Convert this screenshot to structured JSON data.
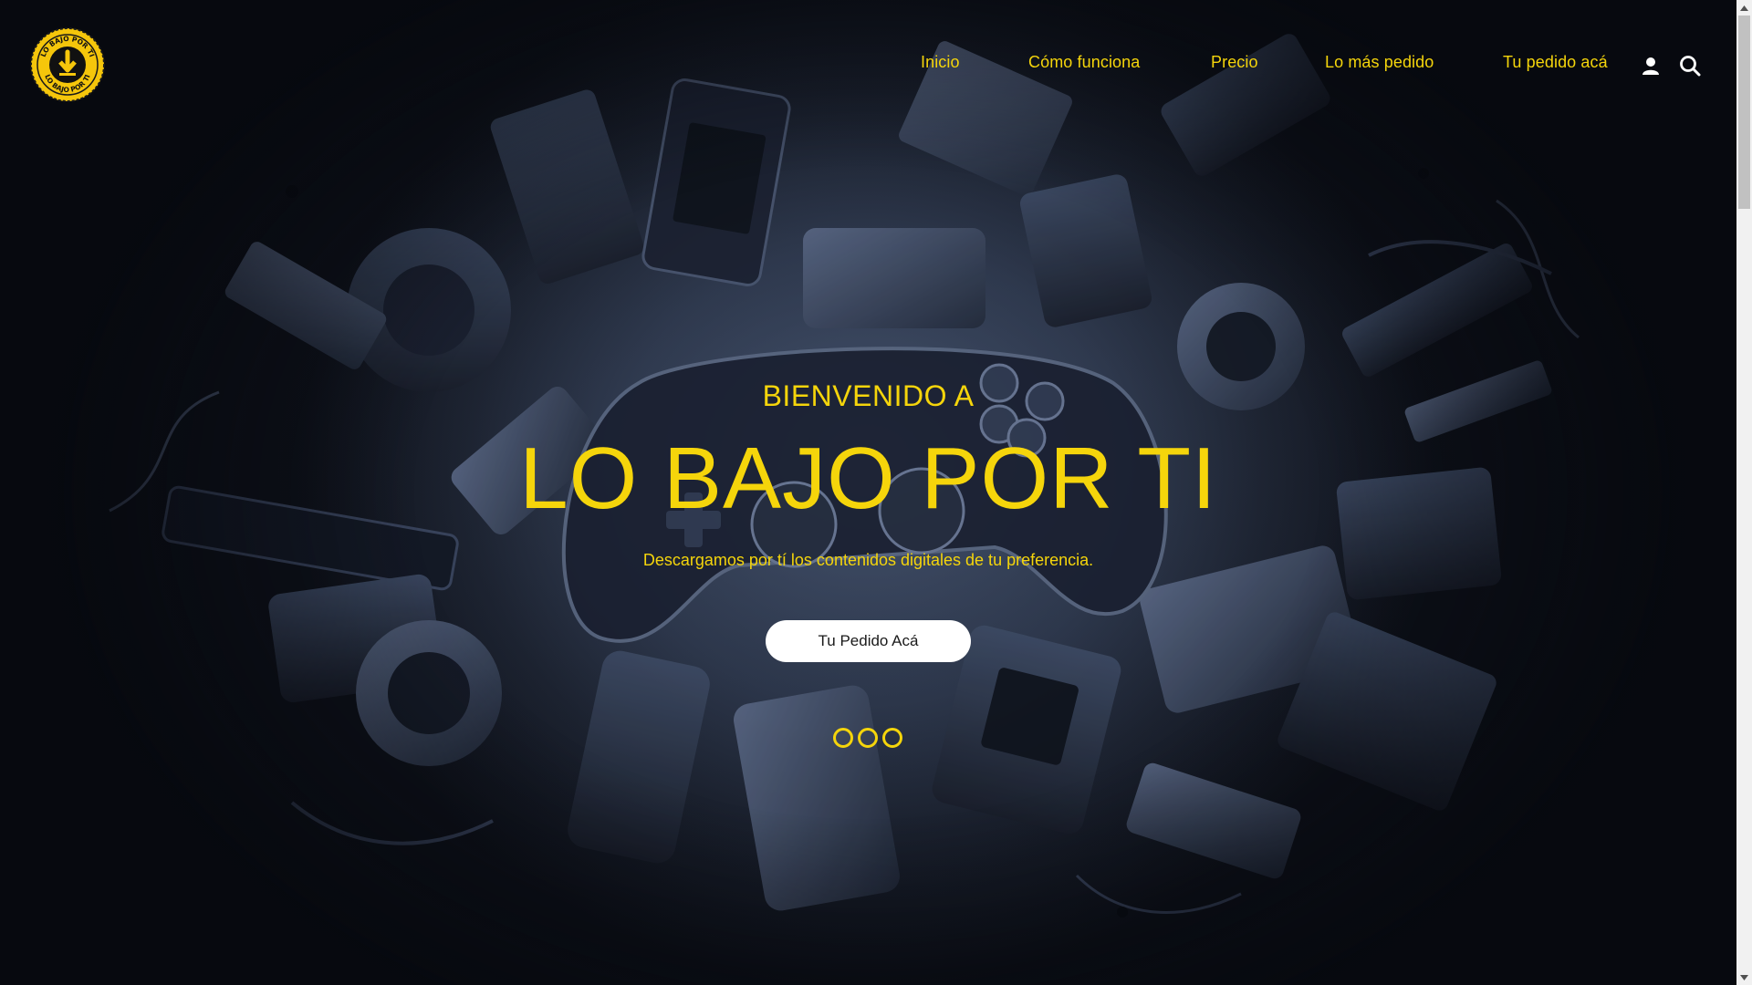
{
  "brand": {
    "logo_text_top": "LO BAJO POR TI",
    "logo_text_bottom": "LO BAJO POR TI",
    "accent_color": "#f5d50b"
  },
  "nav": {
    "items": [
      {
        "label": "Inicio"
      },
      {
        "label": "Cómo funciona"
      },
      {
        "label": "Precio"
      },
      {
        "label": "Lo más pedido"
      },
      {
        "label": "Tu pedido acá"
      }
    ],
    "user_icon": "user-icon",
    "search_icon": "search-icon"
  },
  "hero": {
    "kicker": "BIENVENIDO A",
    "title": "LO BAJO POR TI",
    "subtitle": "Descargamos por tí los contenidos digitales de tu preferencia.",
    "cta_label": "Tu Pedido Acá",
    "slides_count": 3
  },
  "colors": {
    "accent": "#f5d50b",
    "background": "#1a202d",
    "button_bg": "#ffffff",
    "button_text": "#1a1a1a"
  }
}
